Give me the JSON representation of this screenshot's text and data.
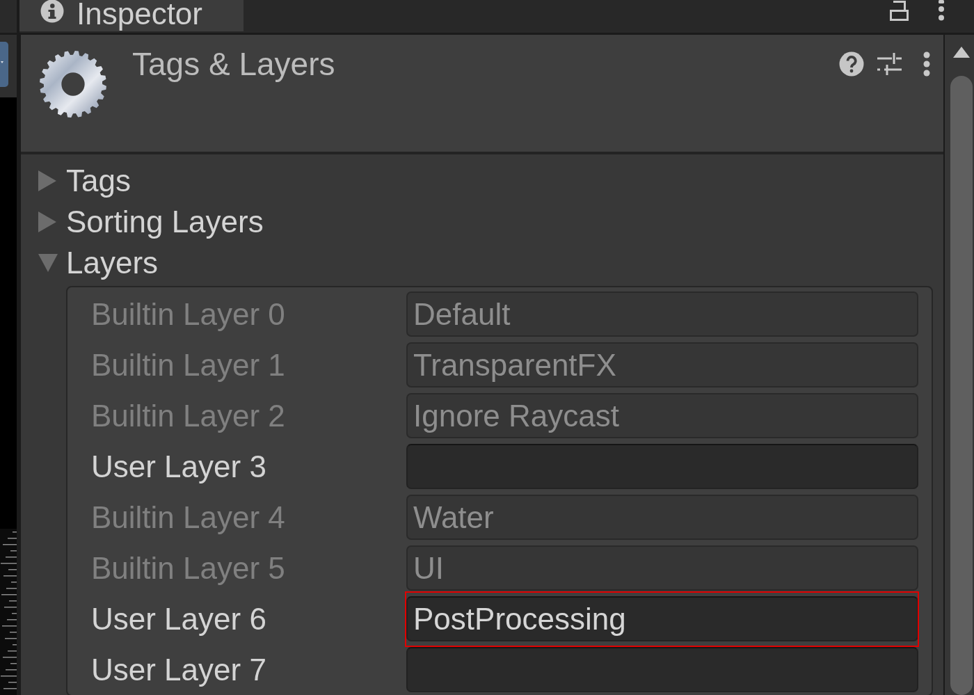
{
  "tab": {
    "title": "Inspector"
  },
  "header": {
    "title": "Tags & Layers"
  },
  "sections": [
    {
      "label": "Tags",
      "expanded": false
    },
    {
      "label": "Sorting Layers",
      "expanded": false
    },
    {
      "label": "Layers",
      "expanded": true,
      "layers": [
        {
          "label": "Builtin Layer 0",
          "value": "Default",
          "disabled": true,
          "highlighted": false
        },
        {
          "label": "Builtin Layer 1",
          "value": "TransparentFX",
          "disabled": true,
          "highlighted": false
        },
        {
          "label": "Builtin Layer 2",
          "value": "Ignore Raycast",
          "disabled": true,
          "highlighted": false
        },
        {
          "label": "User Layer 3",
          "disabled": false,
          "highlighted": false
        },
        {
          "label": "Builtin Layer 4",
          "value": "Water",
          "disabled": true,
          "highlighted": false
        },
        {
          "label": "Builtin Layer 5",
          "value": "UI",
          "disabled": true,
          "highlighted": false
        },
        {
          "label": "User Layer 6",
          "value": "PostProcessing",
          "disabled": false,
          "highlighted": true
        },
        {
          "label": "User Layer 7",
          "disabled": false,
          "highlighted": false
        }
      ]
    }
  ]
}
